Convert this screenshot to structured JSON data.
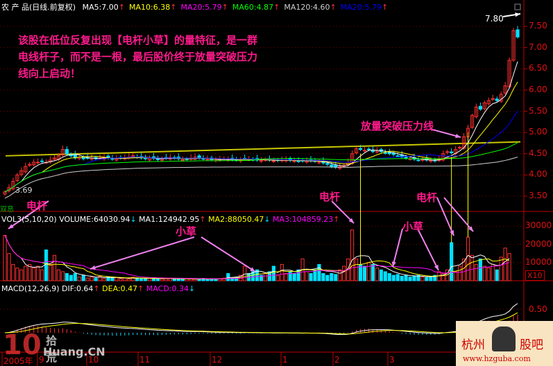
{
  "header": {
    "title": "农 产 品(日线.前复权)",
    "ma": [
      {
        "label": "MA5:7.00",
        "color": "#ffffff",
        "dir": "up"
      },
      {
        "label": "MA10:6.38",
        "color": "#ffff00",
        "dir": "up"
      },
      {
        "label": "MA20:5.79",
        "color": "#ff00ff",
        "dir": "up"
      },
      {
        "label": "MA60:4.87",
        "color": "#00ff00",
        "dir": "up"
      },
      {
        "label": "MA120:4.60",
        "color": "#d0d0d0",
        "dir": "up"
      },
      {
        "label": "MA20:5.79",
        "color": "#0000ff",
        "dir": "up"
      }
    ]
  },
  "annotation": {
    "main_note": [
      "该股在低位反复出现【电杆小草】的量特征，是一群",
      "电线杆子，而不是一根，最后股价终于放量突破压力",
      "线向上启动！"
    ],
    "breakout": "放量突破压力线",
    "pole": "电杆",
    "grass": "小草",
    "high_label": "7.80",
    "low_label": "3.69",
    "marker": "双息"
  },
  "volume_header": {
    "title": "VOL3(5,10,20)",
    "volume": "VOLUME:64030.94",
    "ma1": "MA1:124942.95",
    "ma2": "MA2:88050.47",
    "ma3": "MA3:104859.23",
    "scale": "X10"
  },
  "macd_header": {
    "title": "MACD(12,26,9)",
    "dif": "DIF:0.64",
    "dea": "DEA:0.47",
    "macd": "MACD:0.34"
  },
  "axes": {
    "price_ticks": [
      "7.50",
      "7.00",
      "6.50",
      "6.00",
      "5.50",
      "5.00",
      "4.50",
      "4.00",
      "3.50"
    ],
    "volume_ticks": [
      "30000",
      "20000",
      "10000"
    ],
    "macd_ticks": [
      "0.50"
    ],
    "date_ticks": [
      "2005年",
      "9",
      "10",
      "11",
      "12",
      "1",
      "2",
      "3"
    ]
  },
  "watermarks": {
    "left": "10 拾荒网 Huang.CN",
    "right_name": "杭州 股吧",
    "right_url": "www.hzguba.com"
  },
  "colors": {
    "up": "#ff3030",
    "down": "#00e0ff",
    "axis": "#c00000",
    "annotation": "#ff1a8c",
    "arrow": "#ee82ee",
    "pressure_line": "#c8c800"
  },
  "chart_data": {
    "type": "candlestick",
    "close": [
      3.6,
      3.7,
      3.85,
      4.0,
      4.1,
      4.2,
      4.25,
      4.3,
      4.3,
      4.32,
      4.3,
      4.35,
      4.4,
      4.45,
      4.6,
      4.5,
      4.45,
      4.4,
      4.42,
      4.38,
      4.4,
      4.4,
      4.38,
      4.4,
      4.42,
      4.4,
      4.37,
      4.38,
      4.4,
      4.41,
      4.42,
      4.45,
      4.42,
      4.4,
      4.38,
      4.4,
      4.39,
      4.36,
      4.38,
      4.4,
      4.41,
      4.4,
      4.38,
      4.36,
      4.37,
      4.4,
      4.42,
      4.4,
      4.38,
      4.37,
      4.36,
      4.35,
      4.36,
      4.38,
      4.37,
      4.36,
      4.35,
      4.36,
      4.38,
      4.37,
      4.36,
      4.35,
      4.34,
      4.36,
      4.35,
      4.33,
      4.34,
      4.35,
      4.36,
      4.34,
      4.33,
      4.32,
      4.33,
      4.34,
      4.33,
      4.32,
      4.3,
      4.28,
      4.25,
      4.2,
      4.18,
      4.2,
      4.22,
      4.3,
      4.5,
      4.62,
      4.6,
      4.58,
      4.6,
      4.55,
      4.57,
      4.55,
      4.52,
      4.5,
      4.48,
      4.45,
      4.42,
      4.4,
      4.38,
      4.37,
      4.35,
      4.36,
      4.35,
      4.34,
      4.33,
      4.38,
      4.5,
      4.55,
      4.52,
      4.6,
      4.65,
      4.9,
      5.1,
      5.4,
      5.6,
      5.55,
      5.7,
      5.75,
      5.8,
      5.75,
      5.9,
      6.1,
      6.7,
      7.4,
      7.25
    ],
    "volume": [
      25000,
      15000,
      9000,
      7000,
      6000,
      8000,
      9000,
      7000,
      8000,
      6000,
      17000,
      9000,
      14000,
      6000,
      5000,
      4000,
      3000,
      4000,
      2000,
      3000,
      1500,
      2000,
      1500,
      2500,
      1200,
      2000,
      1500,
      1800,
      1200,
      1500,
      1000,
      2000,
      1500,
      1200,
      1000,
      1300,
      1500,
      1200,
      1000,
      1100,
      1300,
      1000,
      900,
      1100,
      1200,
      1000,
      800,
      1000,
      1300,
      900,
      1000,
      1100,
      1200,
      1400,
      4000,
      1500,
      2000,
      3000,
      8000,
      4000,
      5000,
      6000,
      3000,
      4000,
      5000,
      8000,
      3000,
      9000,
      4000,
      5000,
      4000,
      6000,
      12000,
      5000,
      4000,
      6000,
      9000,
      4000,
      3000,
      4000,
      3500,
      6000,
      8000,
      12000,
      28000,
      12000,
      9000,
      8000,
      10000,
      9000,
      7000,
      6000,
      5000,
      4000,
      3000,
      3500,
      2500,
      3000,
      2000,
      2500,
      3000,
      2000,
      1800,
      2000,
      3000,
      5000,
      4000,
      6000,
      21000,
      5000,
      8000,
      12000,
      24000,
      14000,
      9000,
      12000,
      8000,
      7000,
      9000,
      6000,
      13000,
      18000,
      15000
    ],
    "pressure_line": {
      "start": 4.45,
      "end": 4.78
    },
    "high": 7.8,
    "low": 3.69,
    "price_range": [
      3.3,
      7.9
    ]
  }
}
